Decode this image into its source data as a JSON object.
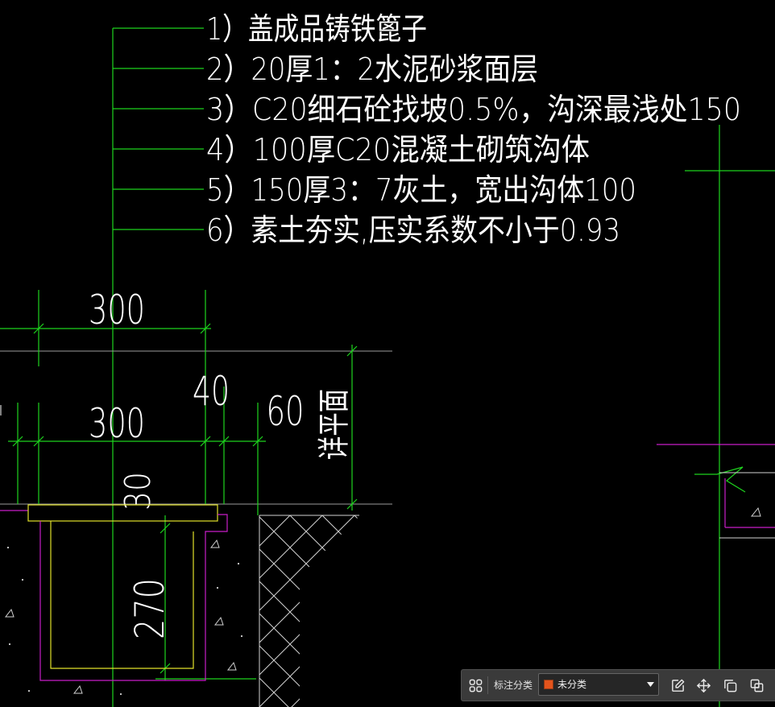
{
  "colors": {
    "canvas": "#000000",
    "leader": "#1ed41e",
    "text": "#ffffff",
    "outline": "#c81ec8",
    "grating": "#e1e12a",
    "hatch": "#d2d2d2",
    "datum": "#9c9c9c",
    "category_swatch": "#e4541c"
  },
  "notes": [
    "1）盖成品铸铁篦子",
    "2）20厚1：2水泥砂浆面层",
    "3）C20细石砼找坡0.5%，沟深最浅处150",
    "4）100厚C20混凝土砌筑沟体",
    "5）150厚3：7灰土，宽出沟体100",
    "6）素土夯实,压实系数不小于0.93"
  ],
  "dimensions": {
    "overall_width": "300",
    "grate_width": "300",
    "ledge": "40",
    "edge": "60",
    "grate_thickness": "30",
    "depth": "270",
    "level_note": "详平面"
  },
  "toolbar": {
    "category_label": "标注分类",
    "category_value": "未分类",
    "icons": [
      "grid-icon",
      "edit-icon",
      "move-icon",
      "copy-icon",
      "paste-icon"
    ]
  }
}
